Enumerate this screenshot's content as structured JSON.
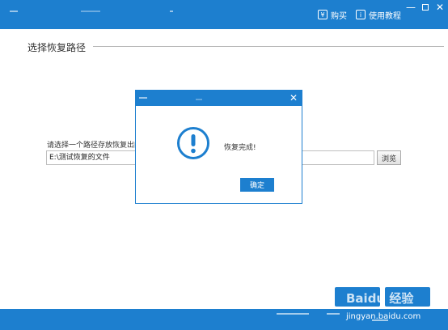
{
  "toolbar": {
    "buy_label": "购买",
    "tutorial_label": "使用教程"
  },
  "main": {
    "section_title": "选择恢复路径",
    "path_label": "请选择一个路径存放恢复出的文",
    "path_value": "E:\\测试恢复的文件",
    "browse_label": "浏览"
  },
  "dialog": {
    "message": "恢复完成!",
    "ok_label": "确定"
  },
  "watermark": {
    "brand": "Baidu 经验",
    "url": "jingyan.baidu.com"
  },
  "colors": {
    "accent": "#1d7fcf"
  }
}
